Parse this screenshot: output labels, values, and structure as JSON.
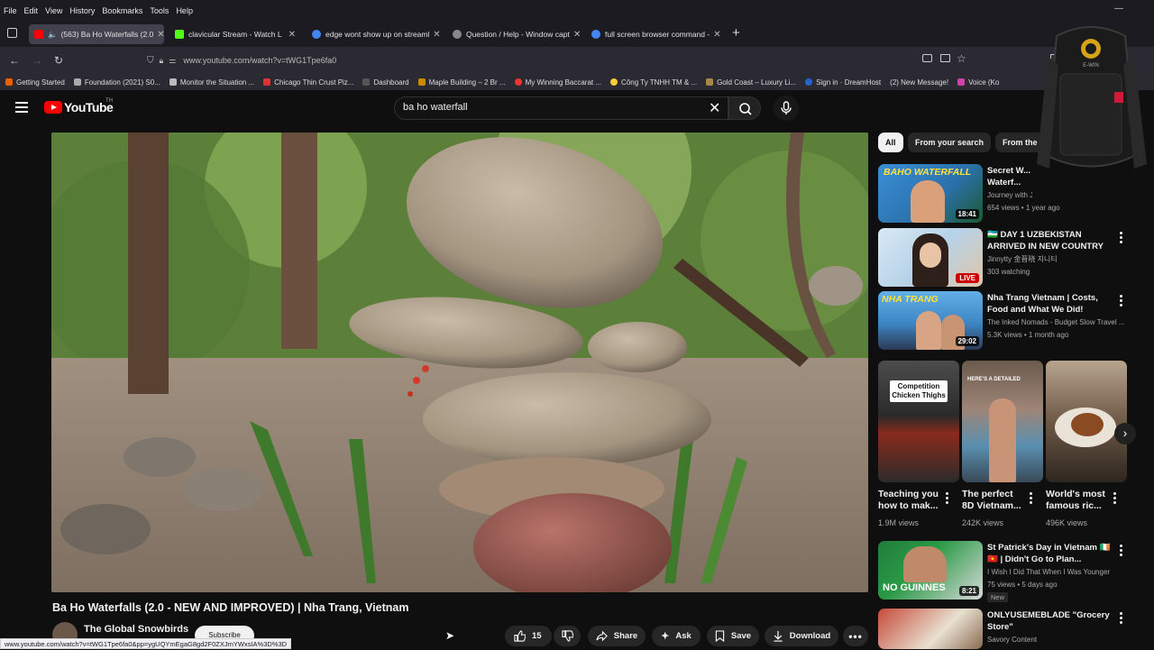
{
  "browser": {
    "menu": [
      "File",
      "Edit",
      "View",
      "History",
      "Bookmarks",
      "Tools",
      "Help"
    ],
    "tabs": [
      {
        "label": "(563) Ba Ho Waterfalls (2.0",
        "active": true,
        "icon_color": "#ff0000"
      },
      {
        "label": "clavicular Stream - Watch L",
        "active": false,
        "icon_color": "#53fc18"
      },
      {
        "label": "edge wont show up on streaml",
        "active": false,
        "icon_color": "#4285f4"
      },
      {
        "label": "Question / Help - Window capt",
        "active": false,
        "icon_color": "#888888"
      },
      {
        "label": "full screen browser command -",
        "active": false,
        "icon_color": "#4285f4"
      }
    ],
    "new_tab": "+",
    "url": "www.youtube.com/watch?v=tWG1Tpe6fa0",
    "bookmarks": [
      "Getting Started",
      "Foundation (2021) S0...",
      "Monitor the Situation ...",
      "Chicago Thin Crust Piz...",
      "Dashboard",
      "Maple Building – 2 Br ...",
      "My Winning Baccarat ...",
      "Công Ty TNHH TM & ...",
      "Gold Coast – Luxury Li...",
      "Sign in · DreamHost",
      "(2) New Message!",
      "Voice (Ko"
    ],
    "status_url": "www.youtube.com/watch?v=tWG1Tpe6fa0&pp=ygUQYmEgaG8gd2F0ZXJmYWxsIA%3D%3D"
  },
  "youtube": {
    "logo": "YouTube",
    "logo_sup": "TH",
    "search_value": "ba ho waterfall",
    "video": {
      "title": "Ba Ho Waterfalls (2.0 - NEW AND IMPROVED) | Nha Trang, Vietnam",
      "channel": "The Global Snowbirds",
      "subscribe": "Subscribe",
      "likes": "15",
      "share": "Share",
      "ask": "Ask",
      "save": "Save",
      "download": "Download"
    },
    "chips": [
      "All",
      "From your search",
      "From the"
    ],
    "recommendations": [
      {
        "thumb_text": "BAHO WATERFALL",
        "duration": "18:41",
        "title": "Secret W... Waterf...",
        "channel": "Journey with Jack",
        "meta": "654 views • 1 year ago"
      },
      {
        "thumb_text": "",
        "duration": "LIVE",
        "title": "🇺🇿 DAY 1 UZBEKISTAN ARRIVED IN NEW COUNTRY UZBEKISTA...",
        "channel": "Jinnytty 金晋晓 지니티",
        "meta": "303 watching"
      },
      {
        "thumb_text": "NHA TRANG",
        "duration": "29:02",
        "title": "Nha Trang Vietnam | Costs, Food and What We Did!",
        "channel": "The Inked Nomads - Budget Slow Travel ...",
        "meta": "5.3K views • 1 month ago"
      }
    ],
    "shorts": [
      {
        "thumb_text": "Competition Chicken Thighs",
        "title": "Teaching you how to mak...",
        "views": "1.9M views"
      },
      {
        "thumb_text": "HERE'S A DETAILED",
        "title": "The perfect 8D Vietnam...",
        "views": "242K views"
      },
      {
        "thumb_text": "",
        "title": "World's most famous ric...",
        "views": "496K views"
      }
    ],
    "more_recs": [
      {
        "thumb_text": "NO GUINNES",
        "duration": "8:21",
        "title": "St Patrick's Day in Vietnam 🇮🇪 🇻🇳 | Didn't Go to Plan... (Episod...",
        "channel": "I Wish I Did That When I Was Younger",
        "meta": "75 views • 5 days ago",
        "badge": "New"
      },
      {
        "thumb_text": "",
        "duration": "",
        "title": "ONLYUSEMEBLADE \"Grocery Store\"",
        "channel": "Savory Content",
        "meta": ""
      }
    ]
  }
}
